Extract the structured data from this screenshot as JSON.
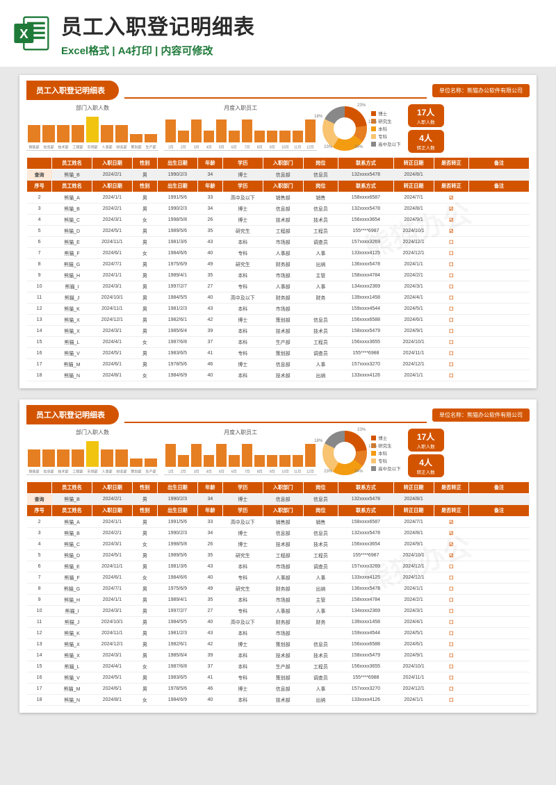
{
  "hero": {
    "title": "员工入职登记明细表",
    "subtitle": "Excel格式 | A4打印 | 内容可修改"
  },
  "sheet": {
    "title": "员工入职登记明细表",
    "unit_label": "单位名称：",
    "unit_value": "熊猫办公软件有限公司"
  },
  "stats": {
    "card1_num": "17人",
    "card1_lbl": "入职人数",
    "card2_num": "4人",
    "card2_lbl": "转正人数"
  },
  "chart_data": [
    {
      "type": "bar",
      "title": "部门入职人数",
      "categories": [
        "销售部",
        "信息部",
        "技术部",
        "工程部",
        "市场部",
        "人事部",
        "财务部",
        "策划部",
        "生产部"
      ],
      "values": [
        2,
        2,
        2,
        2,
        3,
        2,
        2,
        1,
        1
      ],
      "highlight_index": 4,
      "ylim": [
        0,
        4
      ],
      "ylabel": "",
      "xlabel": ""
    },
    {
      "type": "bar",
      "title": "月度入职员工",
      "categories": [
        "1月",
        "2月",
        "3月",
        "4月",
        "5月",
        "6月",
        "7月",
        "8月",
        "9月",
        "10月",
        "11月",
        "12月"
      ],
      "values": [
        2,
        1,
        2,
        1,
        2,
        1,
        2,
        1,
        1,
        1,
        1,
        2
      ],
      "ylim": [
        0,
        3
      ],
      "ylabel": "",
      "xlabel": ""
    },
    {
      "type": "pie",
      "title": "",
      "series": [
        {
          "name": "博士",
          "value": 23,
          "color": "#d35400"
        },
        {
          "name": "研究生",
          "value": 12,
          "color": "#e67e22"
        },
        {
          "name": "本科",
          "value": 24,
          "color": "#f39c12"
        },
        {
          "name": "专科",
          "value": 23,
          "color": "#f8c471"
        },
        {
          "name": "高中及以下",
          "value": 18,
          "color": "#888"
        }
      ]
    }
  ],
  "headers": [
    "序号",
    "员工姓名",
    "入职日期",
    "性别",
    "出生日期",
    "年龄",
    "学历",
    "入职部门",
    "岗位",
    "联系方式",
    "转正日期",
    "是否转正",
    "备注"
  ],
  "search_label": "查询",
  "search_row": [
    "",
    "熊猫_B",
    "2024/2/1",
    "男",
    "1990/2/3",
    "34",
    "博士",
    "信息部",
    "信息员",
    "132xxxx5478",
    "2024/8/1",
    "",
    ""
  ],
  "rows": [
    [
      "2",
      "熊猫_A",
      "2024/1/1",
      "男",
      "1991/5/6",
      "33",
      "高中及以下",
      "销售部",
      "销售",
      "158xxxx6587",
      "2024/7/1",
      "☑",
      ""
    ],
    [
      "3",
      "熊猫_B",
      "2024/2/1",
      "男",
      "1990/2/3",
      "34",
      "博士",
      "信息部",
      "信息员",
      "132xxxx5478",
      "2024/8/1",
      "☑",
      ""
    ],
    [
      "4",
      "熊猫_C",
      "2024/3/1",
      "女",
      "1998/5/8",
      "26",
      "博士",
      "技术部",
      "技术员",
      "156xxxx3654",
      "2024/9/1",
      "☑",
      ""
    ],
    [
      "5",
      "熊猫_D",
      "2024/5/1",
      "男",
      "1989/5/6",
      "35",
      "研究生",
      "工程部",
      "工程员",
      "155****6987",
      "2024/10/1",
      "☑",
      ""
    ],
    [
      "6",
      "熊猫_E",
      "2024/11/1",
      "男",
      "1981/3/6",
      "43",
      "本科",
      "市场部",
      "调查员",
      "157xxxx3269",
      "2024/12/1",
      "☐",
      ""
    ],
    [
      "7",
      "熊猫_F",
      "2024/6/1",
      "女",
      "1984/6/6",
      "40",
      "专科",
      "人事部",
      "人事",
      "133xxxx4125",
      "2024/12/1",
      "☐",
      ""
    ],
    [
      "8",
      "熊猫_G",
      "2024/7/1",
      "男",
      "1975/6/9",
      "49",
      "研究生",
      "财务部",
      "出纳",
      "136xxxx5478",
      "2024/1/1",
      "☐",
      ""
    ],
    [
      "9",
      "熊猫_H",
      "2024/1/1",
      "男",
      "1989/4/1",
      "35",
      "本科",
      "市场部",
      "主管",
      "158xxxx4784",
      "2024/2/1",
      "☐",
      ""
    ],
    [
      "10",
      "熊猫_I",
      "2024/3/1",
      "男",
      "1997/2/7",
      "27",
      "专科",
      "人事部",
      "人事",
      "134xxxx2369",
      "2024/3/1",
      "☐",
      ""
    ],
    [
      "11",
      "熊猫_J",
      "2024/10/1",
      "男",
      "1984/5/5",
      "40",
      "高中及以下",
      "财务部",
      "财务",
      "139xxxx1458",
      "2024/4/1",
      "☐",
      ""
    ],
    [
      "12",
      "熊猫_K",
      "2024/11/1",
      "男",
      "1981/2/3",
      "43",
      "本科",
      "市场部",
      "",
      "159xxxx4544",
      "2024/5/1",
      "☐",
      ""
    ],
    [
      "13",
      "熊猫_X",
      "2024/12/1",
      "男",
      "1982/6/1",
      "42",
      "博士",
      "策划部",
      "信息员",
      "156xxxx6588",
      "2024/6/1",
      "☐",
      ""
    ],
    [
      "14",
      "熊猫_X",
      "2024/3/1",
      "男",
      "1985/6/4",
      "39",
      "本科",
      "技术部",
      "技术员",
      "158xxxx5479",
      "2024/9/1",
      "☐",
      ""
    ],
    [
      "15",
      "熊猫_L",
      "2024/4/1",
      "女",
      "1987/6/8",
      "37",
      "本科",
      "生产部",
      "工程员",
      "156xxxx3655",
      "2024/10/1",
      "☐",
      ""
    ],
    [
      "16",
      "熊猫_V",
      "2024/5/1",
      "男",
      "1983/6/5",
      "41",
      "专科",
      "策划部",
      "调查员",
      "155****6988",
      "2024/11/1",
      "☐",
      ""
    ],
    [
      "17",
      "熊猫_M",
      "2024/6/1",
      "男",
      "1978/5/6",
      "46",
      "博士",
      "信息部",
      "人事",
      "157xxxx3270",
      "2024/12/1",
      "☐",
      ""
    ],
    [
      "18",
      "熊猫_N",
      "2024/8/1",
      "女",
      "1984/6/9",
      "40",
      "本科",
      "技术部",
      "出纳",
      "133xxxx4126",
      "2024/1/1",
      "☐",
      ""
    ]
  ],
  "watermark": "熊猫办公"
}
